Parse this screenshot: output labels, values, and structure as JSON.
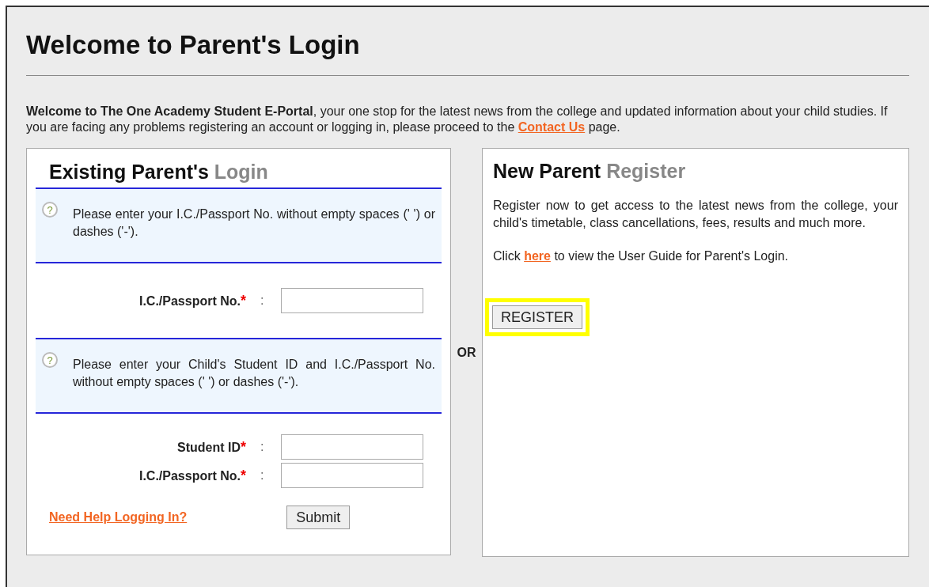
{
  "page": {
    "title": "Welcome to Parent's Login"
  },
  "intro": {
    "text_before": "**Welcome to The One Academy Student E-Portal**, your one stop for the latest news from the college and updated information about your child studies. If you are facing any problems registering an account or logging in, please proceed to the",
    "link": "Contact Us",
    "text_after": "page."
  },
  "login_panel": {
    "heading": "Existing Parent's",
    "heading_accent": "Login",
    "sections": [
      {
        "hint_icon": "?",
        "hint": "Please enter your I.C./Passport No. without empty spaces (' ') or dashes ('-').",
        "fields": [
          {
            "label": "I.C./Passport No.",
            "required_mark": "*",
            "colon": ":"
          }
        ]
      },
      {
        "hint_icon": "?",
        "hint": "Please enter your Child's Student ID and I.C./Passport No. without empty spaces (' ') or dashes ('-').",
        "fields": [
          {
            "label": "Student ID",
            "required_mark": "*",
            "colon": ":"
          },
          {
            "label": "I.C./Passport No.",
            "required_mark": "*",
            "colon": ":"
          }
        ]
      }
    ],
    "help_link": "Need Help Logging In?",
    "submit": "Submit"
  },
  "separator": "OR",
  "register_panel": {
    "heading": "New Parent",
    "heading_accent": "Register",
    "description": "Register now to get access to the latest news from the college, your child's timetable, class cancellations, fees, results and much more.",
    "guide_before": "Click",
    "guide_link": "here",
    "guide_after": "to view the User Guide for Parent's Login.",
    "button": {
      "label": "REGISTER",
      "highlighted": true
    }
  }
}
